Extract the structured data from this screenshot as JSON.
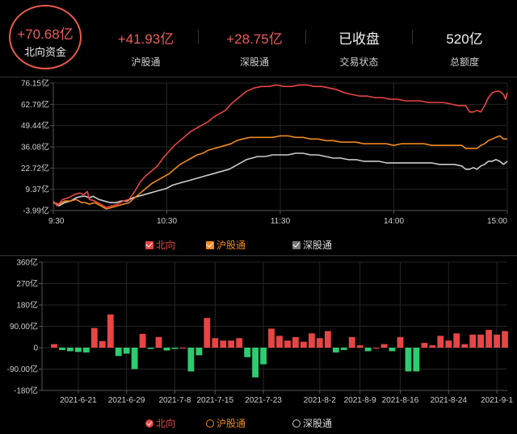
{
  "header": {
    "main": {
      "value": "+70.68亿",
      "label": "北向资金"
    },
    "stats": [
      {
        "value": "+41.93亿",
        "label": "沪股通",
        "color": "#f05a5a"
      },
      {
        "value": "+28.75亿",
        "label": "深股通",
        "color": "#f05a5a"
      },
      {
        "value": "已收盘",
        "label": "交易状态",
        "color": "#f2f2f2"
      },
      {
        "value": "520亿",
        "label": "总额度",
        "color": "#f2f2f2"
      }
    ]
  },
  "legend_top": [
    {
      "name": "北向",
      "color": "#e84545"
    },
    {
      "name": "沪股通",
      "color": "#f08a1e"
    },
    {
      "name": "深股通",
      "color": "#cccccc"
    }
  ],
  "legend_bottom": [
    {
      "name": "北向",
      "color": "#e84545"
    },
    {
      "name": "沪股通",
      "color": "#f08a1e"
    },
    {
      "name": "深股通",
      "color": "#cccccc"
    }
  ],
  "chart_data": [
    {
      "type": "line",
      "y_tick_labels": [
        "76.15亿",
        "62.79亿",
        "49.44亿",
        "36.08亿",
        "22.72亿",
        "9.37亿",
        "-3.99亿"
      ],
      "y_ticks": [
        76.15,
        62.79,
        49.44,
        36.08,
        22.72,
        9.37,
        -3.99
      ],
      "ylim": [
        -3.99,
        76.15
      ],
      "x_tick_labels": [
        "9:30",
        "10:30",
        "11:30",
        "14:00",
        "15:00"
      ],
      "x_ticks": [
        0,
        60,
        120,
        180,
        240
      ],
      "xlim": [
        0,
        240
      ],
      "grid": true,
      "series": [
        {
          "name": "北向",
          "color": "#e84545",
          "points": [
            [
              0,
              2
            ],
            [
              2,
              -1
            ],
            [
              5,
              3
            ],
            [
              8,
              4
            ],
            [
              11,
              6
            ],
            [
              14,
              7
            ],
            [
              16,
              6
            ],
            [
              18,
              8
            ],
            [
              19,
              3
            ],
            [
              22,
              2
            ],
            [
              25,
              0
            ],
            [
              28,
              -2
            ],
            [
              31,
              -1
            ],
            [
              34,
              0
            ],
            [
              37,
              2
            ],
            [
              40,
              3
            ],
            [
              43,
              8
            ],
            [
              46,
              14
            ],
            [
              49,
              18
            ],
            [
              52,
              21
            ],
            [
              55,
              24
            ],
            [
              58,
              29
            ],
            [
              61,
              33
            ],
            [
              64,
              37
            ],
            [
              67,
              40
            ],
            [
              70,
              43
            ],
            [
              73,
              46
            ],
            [
              76,
              48
            ],
            [
              79,
              50
            ],
            [
              82,
              52
            ],
            [
              85,
              55
            ],
            [
              88,
              57
            ],
            [
              91,
              59
            ],
            [
              94,
              63
            ],
            [
              97,
              66
            ],
            [
              99,
              68
            ],
            [
              102,
              71
            ],
            [
              106,
              73
            ],
            [
              110,
              74
            ],
            [
              114,
              74
            ],
            [
              118,
              75
            ],
            [
              122,
              74
            ],
            [
              126,
              74
            ],
            [
              130,
              75
            ],
            [
              134,
              75
            ],
            [
              138,
              74
            ],
            [
              142,
              74
            ],
            [
              146,
              73
            ],
            [
              150,
              72
            ],
            [
              154,
              70
            ],
            [
              158,
              69
            ],
            [
              162,
              68
            ],
            [
              166,
              68
            ],
            [
              170,
              67
            ],
            [
              174,
              67
            ],
            [
              178,
              66
            ],
            [
              182,
              66
            ],
            [
              186,
              65
            ],
            [
              190,
              65
            ],
            [
              194,
              65
            ],
            [
              198,
              64
            ],
            [
              202,
              64
            ],
            [
              206,
              64
            ],
            [
              210,
              63
            ],
            [
              214,
              62
            ],
            [
              218,
              62
            ],
            [
              220,
              58
            ],
            [
              222,
              58
            ],
            [
              224,
              59
            ],
            [
              226,
              58
            ],
            [
              228,
              62
            ],
            [
              230,
              67
            ],
            [
              232,
              70
            ],
            [
              234,
              71
            ],
            [
              236,
              71
            ],
            [
              238,
              69
            ],
            [
              239,
              66
            ],
            [
              240,
              70
            ]
          ]
        },
        {
          "name": "沪股通",
          "color": "#f08a1e",
          "points": [
            [
              0,
              1
            ],
            [
              3,
              0
            ],
            [
              6,
              2
            ],
            [
              9,
              2
            ],
            [
              12,
              3
            ],
            [
              15,
              1
            ],
            [
              17,
              1
            ],
            [
              19,
              0
            ],
            [
              22,
              1
            ],
            [
              25,
              -1
            ],
            [
              28,
              -3
            ],
            [
              31,
              -2
            ],
            [
              34,
              -1
            ],
            [
              37,
              0
            ],
            [
              40,
              1
            ],
            [
              43,
              4
            ],
            [
              46,
              7
            ],
            [
              49,
              10
            ],
            [
              52,
              13
            ],
            [
              55,
              15
            ],
            [
              58,
              17
            ],
            [
              61,
              19
            ],
            [
              64,
              22
            ],
            [
              67,
              25
            ],
            [
              70,
              27
            ],
            [
              73,
              29
            ],
            [
              76,
              31
            ],
            [
              79,
              32
            ],
            [
              82,
              34
            ],
            [
              85,
              35
            ],
            [
              88,
              36
            ],
            [
              91,
              37
            ],
            [
              94,
              38
            ],
            [
              97,
              40
            ],
            [
              100,
              41
            ],
            [
              104,
              42
            ],
            [
              108,
              42
            ],
            [
              112,
              42
            ],
            [
              116,
              42
            ],
            [
              120,
              43
            ],
            [
              124,
              43
            ],
            [
              128,
              42
            ],
            [
              132,
              42
            ],
            [
              136,
              41
            ],
            [
              140,
              41
            ],
            [
              144,
              40
            ],
            [
              148,
              40
            ],
            [
              152,
              39
            ],
            [
              156,
              39
            ],
            [
              160,
              39
            ],
            [
              164,
              38
            ],
            [
              168,
              38
            ],
            [
              172,
              38
            ],
            [
              176,
              38
            ],
            [
              180,
              37
            ],
            [
              184,
              38
            ],
            [
              188,
              38
            ],
            [
              192,
              38
            ],
            [
              196,
              38
            ],
            [
              200,
              37
            ],
            [
              204,
              37
            ],
            [
              208,
              37
            ],
            [
              212,
              37
            ],
            [
              216,
              37
            ],
            [
              218,
              35
            ],
            [
              220,
              35
            ],
            [
              222,
              35
            ],
            [
              224,
              35
            ],
            [
              226,
              37
            ],
            [
              228,
              38
            ],
            [
              230,
              40
            ],
            [
              232,
              41
            ],
            [
              234,
              42
            ],
            [
              236,
              43
            ],
            [
              238,
              41
            ],
            [
              240,
              41
            ]
          ]
        },
        {
          "name": "深股通",
          "color": "#cccccc",
          "points": [
            [
              0,
              1
            ],
            [
              3,
              -1
            ],
            [
              6,
              1
            ],
            [
              9,
              2
            ],
            [
              12,
              4
            ],
            [
              15,
              5
            ],
            [
              17,
              5
            ],
            [
              19,
              4
            ],
            [
              21,
              5
            ],
            [
              24,
              3
            ],
            [
              27,
              2
            ],
            [
              30,
              1
            ],
            [
              33,
              1
            ],
            [
              36,
              2
            ],
            [
              39,
              2
            ],
            [
              42,
              4
            ],
            [
              45,
              5
            ],
            [
              48,
              6
            ],
            [
              51,
              7
            ],
            [
              54,
              8
            ],
            [
              57,
              9
            ],
            [
              60,
              10
            ],
            [
              63,
              12
            ],
            [
              66,
              13
            ],
            [
              69,
              14
            ],
            [
              72,
              15
            ],
            [
              75,
              16
            ],
            [
              78,
              17
            ],
            [
              81,
              18
            ],
            [
              84,
              19
            ],
            [
              87,
              20
            ],
            [
              90,
              21
            ],
            [
              93,
              22
            ],
            [
              96,
              24
            ],
            [
              99,
              26
            ],
            [
              102,
              28
            ],
            [
              105,
              29
            ],
            [
              108,
              30
            ],
            [
              112,
              30
            ],
            [
              116,
              31
            ],
            [
              120,
              31
            ],
            [
              124,
              31
            ],
            [
              128,
              32
            ],
            [
              132,
              32
            ],
            [
              136,
              31
            ],
            [
              140,
              31
            ],
            [
              144,
              30
            ],
            [
              148,
              29
            ],
            [
              152,
              29
            ],
            [
              156,
              28
            ],
            [
              160,
              28
            ],
            [
              164,
              27
            ],
            [
              168,
              27
            ],
            [
              172,
              27
            ],
            [
              176,
              26
            ],
            [
              180,
              26
            ],
            [
              184,
              26
            ],
            [
              188,
              26
            ],
            [
              192,
              26
            ],
            [
              196,
              26
            ],
            [
              200,
              26
            ],
            [
              204,
              25
            ],
            [
              208,
              25
            ],
            [
              212,
              25
            ],
            [
              216,
              24
            ],
            [
              218,
              22
            ],
            [
              220,
              22
            ],
            [
              222,
              23
            ],
            [
              224,
              22
            ],
            [
              226,
              24
            ],
            [
              228,
              25
            ],
            [
              230,
              27
            ],
            [
              232,
              27
            ],
            [
              234,
              28
            ],
            [
              236,
              27
            ],
            [
              238,
              25
            ],
            [
              240,
              27
            ]
          ]
        }
      ]
    },
    {
      "type": "bar",
      "y_tick_labels": [
        "360亿",
        "270亿",
        "180亿",
        "90.00亿",
        "0",
        "-90.00亿",
        "-180亿"
      ],
      "y_ticks": [
        360,
        270,
        180,
        90,
        0,
        -90,
        -180
      ],
      "ylim": [
        -180,
        360
      ],
      "x_tick_labels": [
        "2021-6-21",
        "2021-6-29",
        "2021-7-8",
        "2021-7-15",
        "2021-7-23",
        "2021-8-2",
        "2021-8-9",
        "2021-8-16",
        "2021-8-24",
        "2021-9-1"
      ],
      "x_tick_indices": [
        3,
        9,
        15,
        20,
        26,
        33,
        38,
        43,
        49,
        55
      ],
      "grid": true,
      "series": [
        {
          "name": "北向",
          "positive_color": "#e84545",
          "negative_color": "#2ecc71",
          "values": [
            15,
            -10,
            -15,
            -18,
            -20,
            83,
            28,
            140,
            -35,
            -25,
            -90,
            58,
            -5,
            45,
            -12,
            -5,
            0,
            -100,
            -32,
            125,
            40,
            30,
            30,
            40,
            -40,
            -125,
            -70,
            80,
            50,
            30,
            45,
            25,
            60,
            40,
            70,
            -20,
            -10,
            45,
            10,
            -15,
            0,
            15,
            -15,
            45,
            -100,
            -100,
            20,
            10,
            50,
            30,
            60,
            15,
            55,
            55,
            75,
            55,
            70
          ]
        }
      ]
    }
  ]
}
